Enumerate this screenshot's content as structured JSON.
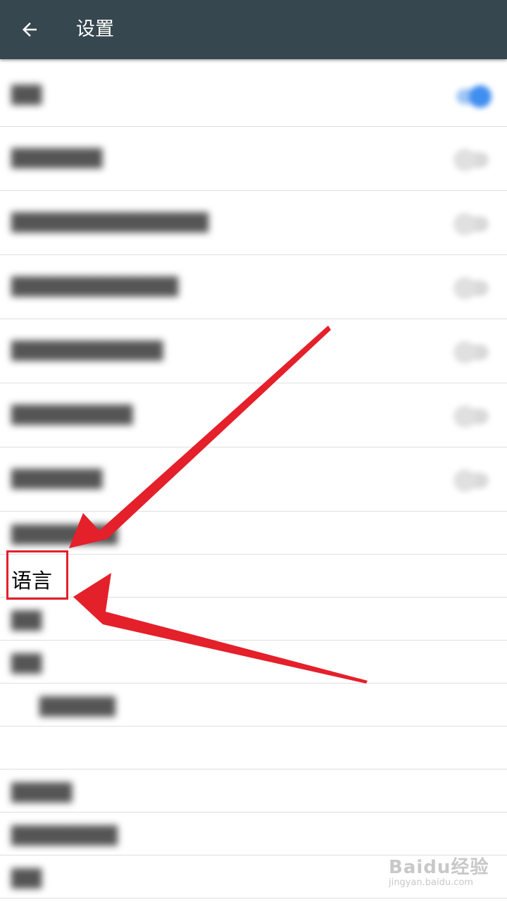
{
  "header": {
    "title": "设置",
    "back_icon": "arrow-left-icon"
  },
  "settings": {
    "language_label": "语言"
  },
  "annotation": {
    "color": "#e4202b"
  },
  "watermark": {
    "main": "Baidu经验",
    "sub": "jingyan.baidu.com"
  },
  "colors": {
    "appbar": "#37474f",
    "toggle_on": "#3f8ef0"
  }
}
